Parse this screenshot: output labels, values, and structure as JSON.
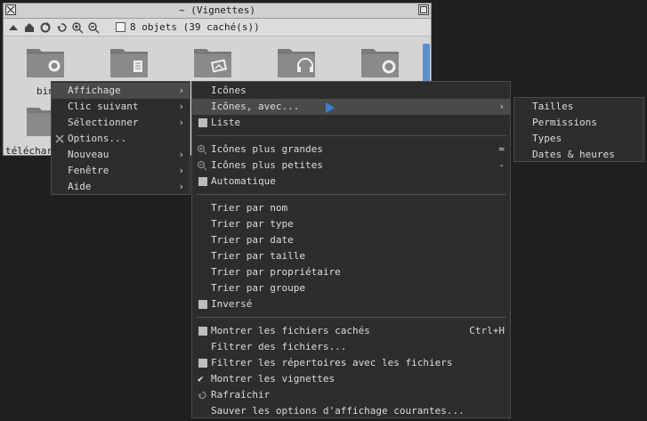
{
  "window": {
    "title": "~ (Vignettes)",
    "object_count": "8 objets (39 caché(s))",
    "files": [
      {
        "label": "bin",
        "icon": "settings-folder-icon"
      },
      {
        "label": "",
        "icon": "notebook-folder-icon"
      },
      {
        "label": "",
        "icon": "photo-folder-icon"
      },
      {
        "label": "",
        "icon": "music-folder-icon"
      },
      {
        "label": "",
        "icon": "disc-folder-icon"
      },
      {
        "label": "télécharg",
        "icon": "download-folder-icon"
      }
    ]
  },
  "main_menu": {
    "items": [
      {
        "label": "Affichage",
        "submenu": "›"
      },
      {
        "label": "Clic suivant",
        "submenu": "›"
      },
      {
        "label": "Sélectionner",
        "submenu": "›"
      },
      {
        "label": "Options...",
        "icon": "tools-icon"
      },
      {
        "label": "Nouveau",
        "submenu": "›"
      },
      {
        "label": "Fenêtre",
        "submenu": "›"
      },
      {
        "label": "Aide",
        "submenu": "›"
      }
    ]
  },
  "display_menu": {
    "items": [
      {
        "label": "Icônes"
      },
      {
        "label": "Icônes, avec...",
        "submenu": "›"
      },
      {
        "label": "Liste"
      },
      {
        "label": "Icônes plus grandes",
        "accel": "="
      },
      {
        "label": "Icônes plus petites",
        "accel": "-"
      },
      {
        "label": "Automatique"
      },
      {
        "label": "Trier par nom"
      },
      {
        "label": "Trier par type"
      },
      {
        "label": "Trier par date"
      },
      {
        "label": "Trier par taille"
      },
      {
        "label": "Trier par propriétaire"
      },
      {
        "label": "Trier par groupe"
      },
      {
        "label": "Inversé"
      },
      {
        "label": "Montrer les fichiers cachés",
        "accel": "Ctrl+H"
      },
      {
        "label": "Filtrer des fichiers..."
      },
      {
        "label": "Filtrer les répertoires avec les fichiers"
      },
      {
        "label": "Montrer les vignettes",
        "check": "✔"
      },
      {
        "label": "Rafraîchir"
      },
      {
        "label": "Sauver les options d'affichage courantes..."
      }
    ]
  },
  "with_menu": {
    "items": [
      {
        "label": "Tailles"
      },
      {
        "label": "Permissions"
      },
      {
        "label": "Types"
      },
      {
        "label": "Dates & heures"
      }
    ]
  },
  "colors": {
    "menu_bg": "#2d2d2d",
    "highlight": "#4a4a4a",
    "cursor": "#3d7fd6"
  }
}
